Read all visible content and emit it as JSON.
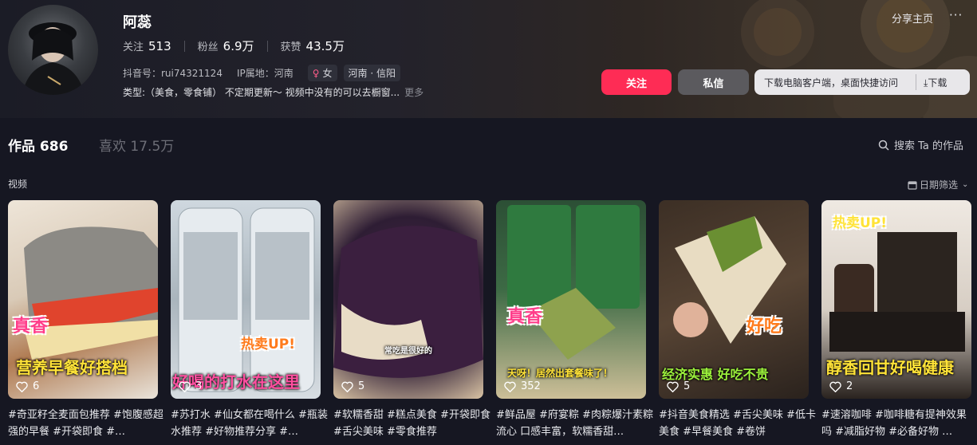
{
  "profile": {
    "name": "阿蕊",
    "stats": [
      {
        "label": "关注",
        "value": "513"
      },
      {
        "label": "粉丝",
        "value": "6.9万"
      },
      {
        "label": "获赞",
        "value": "43.5万"
      }
    ],
    "douyin_id": "抖音号：rui74321124",
    "ip_location": "IP属地：河南",
    "gender": "女",
    "region": "河南 · 信阳",
    "description": "类型:（美食，零食铺） 不定期更新～ 视频中没有的可以去橱窗...",
    "more": "更多"
  },
  "header_actions": {
    "share": "分享主页",
    "more": "···",
    "follow": "关注",
    "message": "私信",
    "download_prompt": "下载电脑客户端，桌面快捷访问",
    "download": "下载"
  },
  "tabs": {
    "works": "作品 686",
    "likes": "喜欢 17.5万",
    "search": "搜索 Ta 的作品"
  },
  "section": {
    "label": "视频",
    "filter": "日期筛选"
  },
  "cards": [
    {
      "likes": "6",
      "overlay": "营养早餐好搭档",
      "sticker": "真香",
      "caption": "#奇亚籽全麦面包推荐 #饱腹感超强的早餐 #开袋即食 #…"
    },
    {
      "likes": "3",
      "overlay": "好喝的打水在这里",
      "sticker": "热卖UP!",
      "caption": "#苏打水 #仙女都在喝什么 #瓶装水推荐 #好物推荐分享 #…"
    },
    {
      "likes": "5",
      "overlay": "常吃是很好的",
      "sticker": "",
      "caption": "#软糯香甜 #糕点美食 #开袋即食 #舌尖美味 #零食推荐"
    },
    {
      "likes": "352",
      "overlay": "天呀！居然出套餐味了！",
      "sticker": "真香",
      "caption": "#鲜品屋 #府宴粽 #肉粽爆汁素粽流心 口感丰富，软糯香甜…"
    },
    {
      "likes": "5",
      "overlay": "经济实惠 好吃不贵",
      "sticker": "好吃",
      "caption": "#抖音美食精选 #舌尖美味 #低卡美食 #早餐美食 #卷饼"
    },
    {
      "likes": "2",
      "overlay": "醇香回甘好喝健康",
      "sticker": "热卖UP!",
      "caption": "#速溶咖啡 #咖啡糖有提神效果吗 #减脂好物 #必备好物 …"
    }
  ],
  "colors": {
    "accent": "#fe2c55",
    "background": "#161722"
  }
}
